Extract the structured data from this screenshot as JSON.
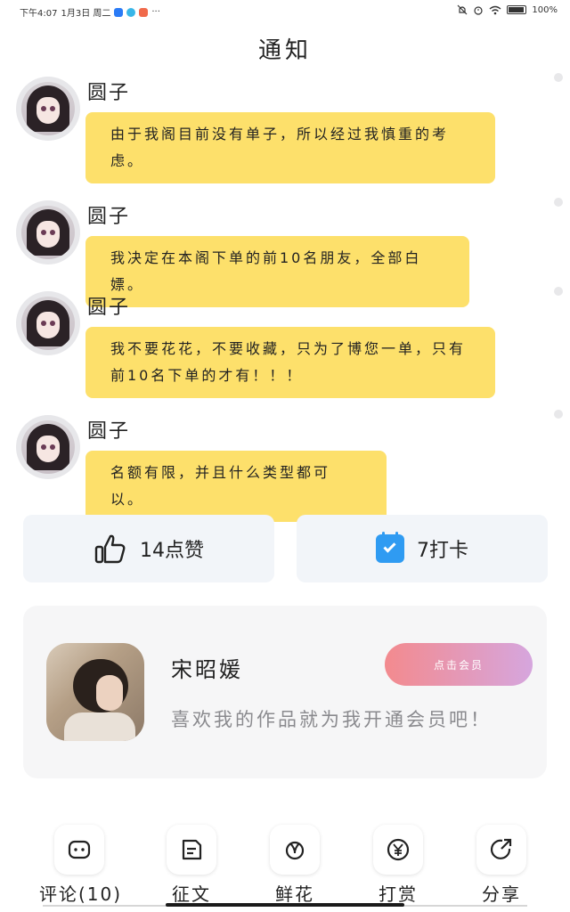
{
  "status_bar": {
    "time": "下午4:07",
    "date": "1月3日 周二",
    "more": "···",
    "battery": "100%"
  },
  "header": {
    "title": "通知"
  },
  "messages": [
    {
      "sender": "圆子",
      "text": "由于我阁目前没有单子，所以经过我慎重的考虑。"
    },
    {
      "sender": "圆子",
      "text": "我决定在本阁下单的前10名朋友，全部白嫖。"
    },
    {
      "sender": "圆子",
      "text": "我不要花花，不要收藏，只为了博您一单，只有前10名下单的才有！！！"
    },
    {
      "sender": "圆子",
      "text": "名额有限，并且什么类型都可以。"
    }
  ],
  "actions": {
    "like_label": "14点赞",
    "checkin_label": "7打卡"
  },
  "member": {
    "name": "宋昭媛",
    "pitch": "喜欢我的作品就为我开通会员吧！",
    "button": "点击会员"
  },
  "tabs": [
    {
      "label": "评论(10)",
      "icon": "comment-icon"
    },
    {
      "label": "征文",
      "icon": "essay-icon"
    },
    {
      "label": "鲜花",
      "icon": "flower-icon"
    },
    {
      "label": "打赏",
      "icon": "yuan-icon"
    },
    {
      "label": "分享",
      "icon": "share-icon"
    }
  ],
  "colors": {
    "bubble": "#fde06b",
    "action_card": "#f2f5f9",
    "checkin_icon": "#2f9bf2",
    "vip_gradient_start": "#f38a8e",
    "vip_gradient_end": "#d6a6de"
  }
}
